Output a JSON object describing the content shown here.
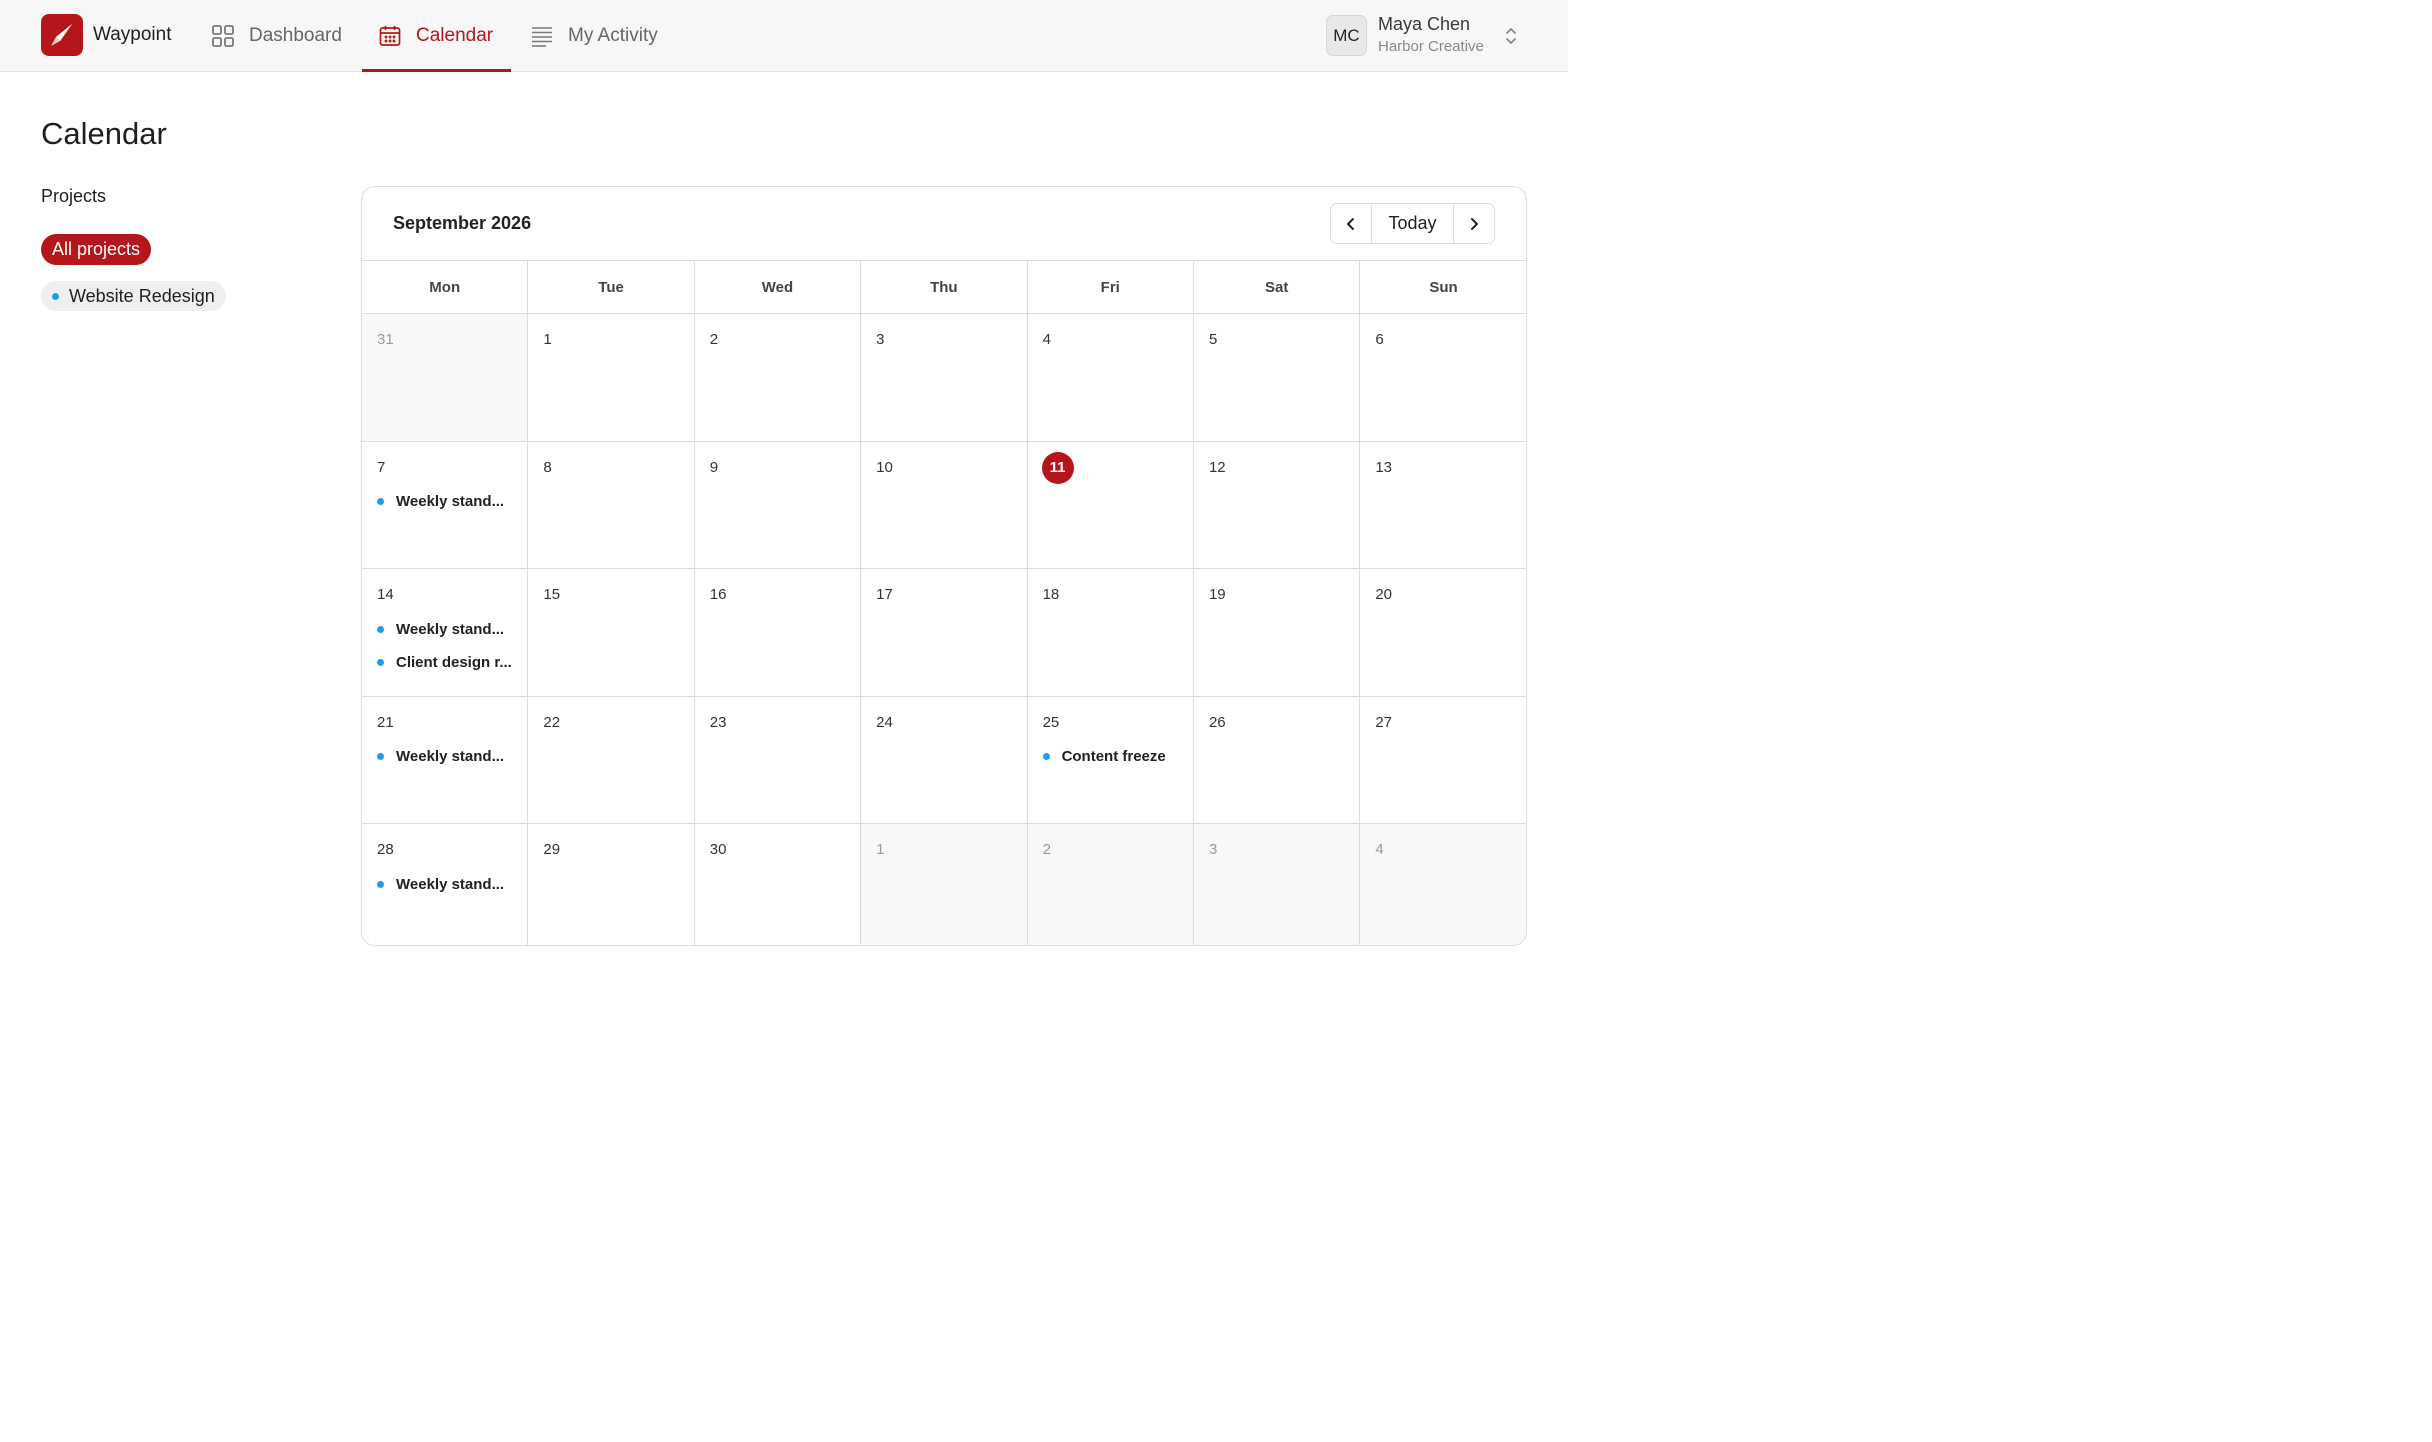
{
  "app": {
    "name": "Waypoint"
  },
  "nav": {
    "items": [
      {
        "label": "Dashboard",
        "icon": "grid-icon",
        "active": false
      },
      {
        "label": "Calendar",
        "icon": "calendar-icon",
        "active": true
      },
      {
        "label": "My Activity",
        "icon": "list-icon",
        "active": false
      }
    ]
  },
  "user": {
    "initials": "MC",
    "name": "Maya Chen",
    "org": "Harbor Creative"
  },
  "page": {
    "title": "Calendar"
  },
  "sidebar": {
    "heading": "Projects",
    "filters": [
      {
        "label": "All projects",
        "selected": true
      },
      {
        "label": "Website Redesign",
        "selected": false,
        "color": "#1aa0e8"
      }
    ]
  },
  "calendar": {
    "month_label": "September 2026",
    "today_label": "Today",
    "weekdays": [
      "Mon",
      "Tue",
      "Wed",
      "Thu",
      "Fri",
      "Sat",
      "Sun"
    ],
    "weeks": [
      [
        {
          "d": "31",
          "muted": true,
          "events": []
        },
        {
          "d": "1",
          "events": []
        },
        {
          "d": "2",
          "events": []
        },
        {
          "d": "3",
          "events": []
        },
        {
          "d": "4",
          "events": []
        },
        {
          "d": "5",
          "events": []
        },
        {
          "d": "6",
          "events": []
        }
      ],
      [
        {
          "d": "7",
          "events": [
            "Weekly stand..."
          ]
        },
        {
          "d": "8",
          "events": []
        },
        {
          "d": "9",
          "events": []
        },
        {
          "d": "10",
          "events": []
        },
        {
          "d": "11",
          "today": true,
          "events": []
        },
        {
          "d": "12",
          "events": []
        },
        {
          "d": "13",
          "events": []
        }
      ],
      [
        {
          "d": "14",
          "events": [
            "Weekly stand...",
            "Client design r..."
          ]
        },
        {
          "d": "15",
          "events": []
        },
        {
          "d": "16",
          "events": []
        },
        {
          "d": "17",
          "events": []
        },
        {
          "d": "18",
          "events": []
        },
        {
          "d": "19",
          "events": []
        },
        {
          "d": "20",
          "events": []
        }
      ],
      [
        {
          "d": "21",
          "events": [
            "Weekly stand..."
          ]
        },
        {
          "d": "22",
          "events": []
        },
        {
          "d": "23",
          "events": []
        },
        {
          "d": "24",
          "events": []
        },
        {
          "d": "25",
          "events": [
            "Content freeze"
          ]
        },
        {
          "d": "26",
          "events": []
        },
        {
          "d": "27",
          "events": []
        }
      ],
      [
        {
          "d": "28",
          "events": [
            "Weekly stand..."
          ]
        },
        {
          "d": "29",
          "events": []
        },
        {
          "d": "30",
          "events": []
        },
        {
          "d": "1",
          "muted": true,
          "events": []
        },
        {
          "d": "2",
          "muted": true,
          "events": []
        },
        {
          "d": "3",
          "muted": true,
          "events": []
        },
        {
          "d": "4",
          "muted": true,
          "events": []
        }
      ]
    ]
  },
  "colors": {
    "accent": "#b5161b",
    "event_dot": "#1aa0e8"
  }
}
